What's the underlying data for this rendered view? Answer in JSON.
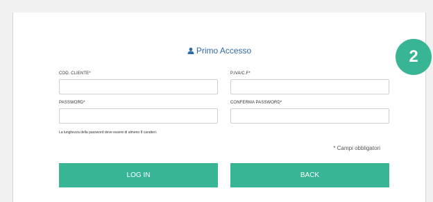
{
  "form": {
    "title": "Primo Accesso",
    "step_number": "2",
    "fields": {
      "cod_cliente_label": "COD. CLIENTE*",
      "piva_label": "P.IVA/C.F*",
      "password_label": "PASSWORD*",
      "conferma_password_label": "CONFERMA PASSWORD*",
      "cod_cliente_value": "",
      "piva_value": "",
      "password_value": "",
      "conferma_password_value": ""
    },
    "password_note": "La lunghezza della password deve essere di almeno 8 caratteri.",
    "required_note": "* Campi obbligatori",
    "login_label": "LOG IN",
    "back_label": "BACK"
  },
  "colors": {
    "accent": "#37b594",
    "title": "#2f6aa8"
  },
  "icons": {
    "title_icon": "user-icon"
  }
}
